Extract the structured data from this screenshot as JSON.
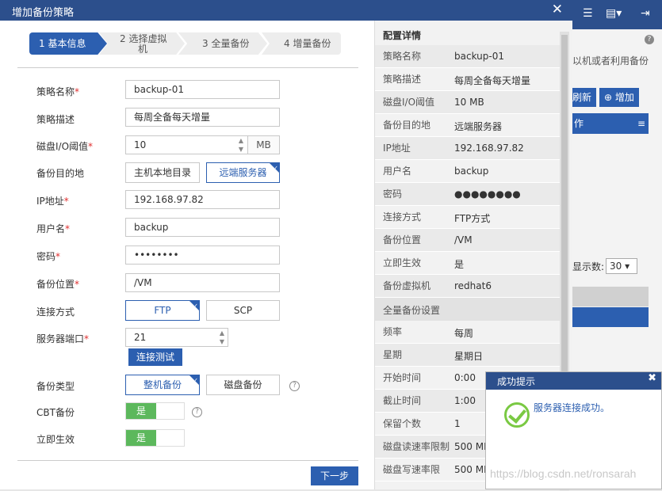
{
  "background": {
    "top_icons": [
      "list-icon",
      "window-icon",
      "logout-icon"
    ],
    "text": "以机或者利用备份",
    "refresh_label": "刷新",
    "add_label": "增加",
    "table_header": "作",
    "per_page_label": "显示数:",
    "per_page_value": "30"
  },
  "dialog": {
    "title": "增加备份策略",
    "steps": [
      {
        "label": "1 基本信息"
      },
      {
        "label": "2 选择虚拟",
        "label2": "机"
      },
      {
        "label": "3 全量备份"
      },
      {
        "label": "4 增量备份"
      }
    ],
    "form": {
      "name_label": "策略名称",
      "name_value": "backup-01",
      "desc_label": "策略描述",
      "desc_value": "每周全备每天增量",
      "io_label": "磁盘I/O阈值",
      "io_value": "10",
      "io_unit": "MB",
      "dest_label": "备份目的地",
      "dest_options": [
        "主机本地目录",
        "远端服务器"
      ],
      "ip_label": "IP地址",
      "ip_value": "192.168.97.82",
      "user_label": "用户名",
      "user_value": "backup",
      "pwd_label": "密码",
      "pwd_value": "••••••••",
      "loc_label": "备份位置",
      "loc_value": "/VM",
      "conn_label": "连接方式",
      "conn_options": [
        "FTP",
        "SCP"
      ],
      "port_label": "服务器端口",
      "port_value": "21",
      "test_button": "连接测试",
      "type_label": "备份类型",
      "type_options": [
        "整机备份",
        "磁盘备份"
      ],
      "cbt_label": "CBT备份",
      "cbt_value": "是",
      "immediate_label": "立即生效",
      "immediate_value": "是",
      "next_button": "下一步"
    },
    "details": {
      "heading": "配置详情",
      "rows": [
        {
          "k": "策略名称",
          "v": "backup-01"
        },
        {
          "k": "策略描述",
          "v": "每周全备每天增量"
        },
        {
          "k": "磁盘I/O阈值",
          "v": "10 MB"
        },
        {
          "k": "备份目的地",
          "v": "远端服务器"
        },
        {
          "k": "IP地址",
          "v": "192.168.97.82"
        },
        {
          "k": "用户名",
          "v": "backup"
        },
        {
          "k": "密码",
          "v": "●●●●●●●●"
        },
        {
          "k": "连接方式",
          "v": "FTP方式"
        },
        {
          "k": "备份位置",
          "v": "/VM"
        },
        {
          "k": "立即生效",
          "v": "是"
        },
        {
          "k": "备份虚拟机",
          "v": "redhat6"
        }
      ],
      "full_section": "全量备份设置",
      "rows2": [
        {
          "k": "频率",
          "v": "每周"
        },
        {
          "k": "星期",
          "v": "星期日"
        },
        {
          "k": "开始时间",
          "v": "0:00"
        },
        {
          "k": "截止时间",
          "v": "1:00"
        },
        {
          "k": "保留个数",
          "v": "1"
        },
        {
          "k": "磁盘读速率限制",
          "v": "500 MB"
        },
        {
          "k": "磁盘写速率限",
          "v": "500 MB"
        }
      ]
    }
  },
  "toast": {
    "title": "成功提示",
    "message": "服务器连接成功。"
  },
  "watermark": "https://blog.csdn.net/ronsarah"
}
